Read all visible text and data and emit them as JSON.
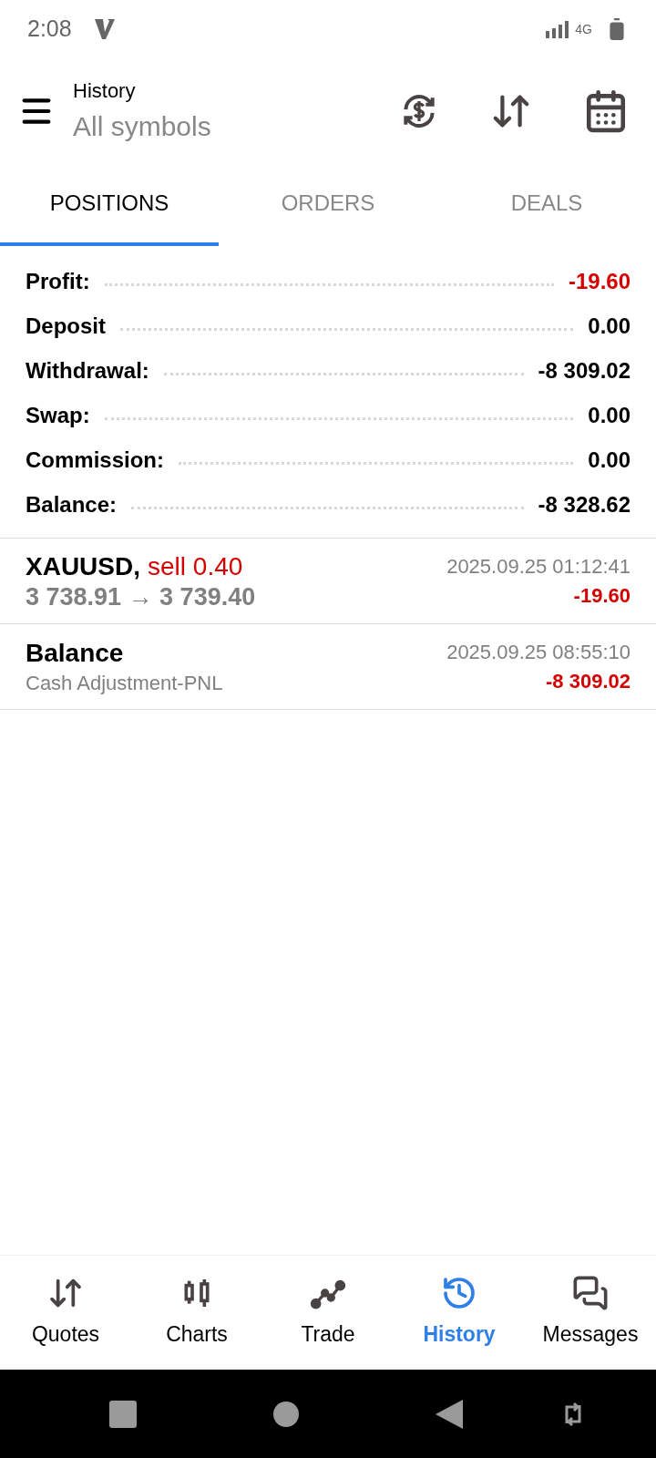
{
  "status_bar": {
    "time": "2:08",
    "network": "4G"
  },
  "toolbar": {
    "title": "History",
    "subtitle": "All symbols"
  },
  "tabs": [
    {
      "label": "POSITIONS",
      "selected": true
    },
    {
      "label": "ORDERS",
      "selected": false
    },
    {
      "label": "DEALS",
      "selected": false
    }
  ],
  "summary": [
    {
      "label": "Profit:",
      "value": "-19.60",
      "negative": true
    },
    {
      "label": "Deposit",
      "value": "0.00",
      "negative": false
    },
    {
      "label": "Withdrawal:",
      "value": "-8 309.02",
      "negative": false
    },
    {
      "label": "Swap:",
      "value": "0.00",
      "negative": false
    },
    {
      "label": "Commission:",
      "value": "0.00",
      "negative": false
    },
    {
      "label": "Balance:",
      "value": "-8 328.62",
      "negative": false
    }
  ],
  "deals": [
    {
      "kind": "trade",
      "symbol": "XAUUSD,",
      "side": "sell 0.40",
      "prices": "3 738.91 → 3 739.40",
      "time": "2025.09.25 01:12:41",
      "profit": "-19.60"
    },
    {
      "kind": "balance",
      "symbol": "Balance",
      "comment": "Cash Adjustment-PNL",
      "time": "2025.09.25 08:55:10",
      "profit": "-8 309.02"
    }
  ],
  "bottom_nav": [
    {
      "label": "Quotes",
      "selected": false
    },
    {
      "label": "Charts",
      "selected": false
    },
    {
      "label": "Trade",
      "selected": false
    },
    {
      "label": "History",
      "selected": true
    },
    {
      "label": "Messages",
      "selected": false
    }
  ]
}
